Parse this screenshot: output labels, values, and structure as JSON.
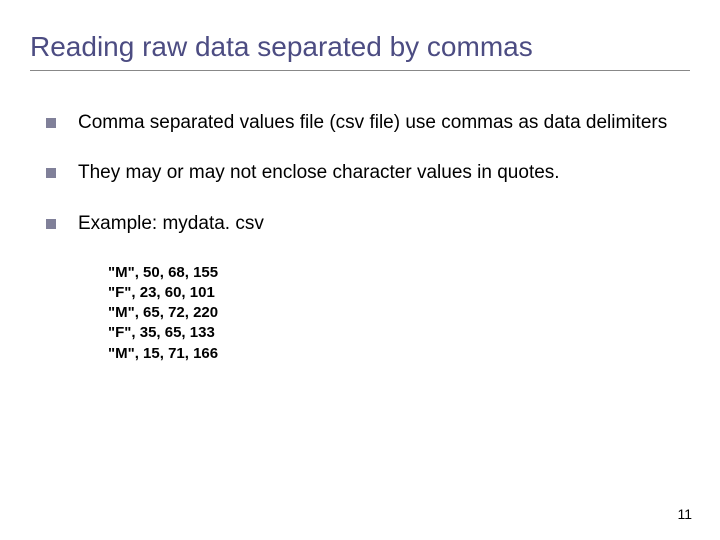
{
  "title": "Reading raw data separated by commas",
  "bullets": [
    "Comma separated values file (csv file) use commas as data delimiters",
    "They may or may not enclose character values in quotes.",
    "Example: mydata. csv"
  ],
  "datalines": [
    "\"M\", 50, 68, 155",
    "\"F\", 23, 60, 101",
    "\"M\", 65, 72, 220",
    "\"F\", 35, 65, 133",
    "\"M\", 15, 71, 166"
  ],
  "page_number": "11"
}
